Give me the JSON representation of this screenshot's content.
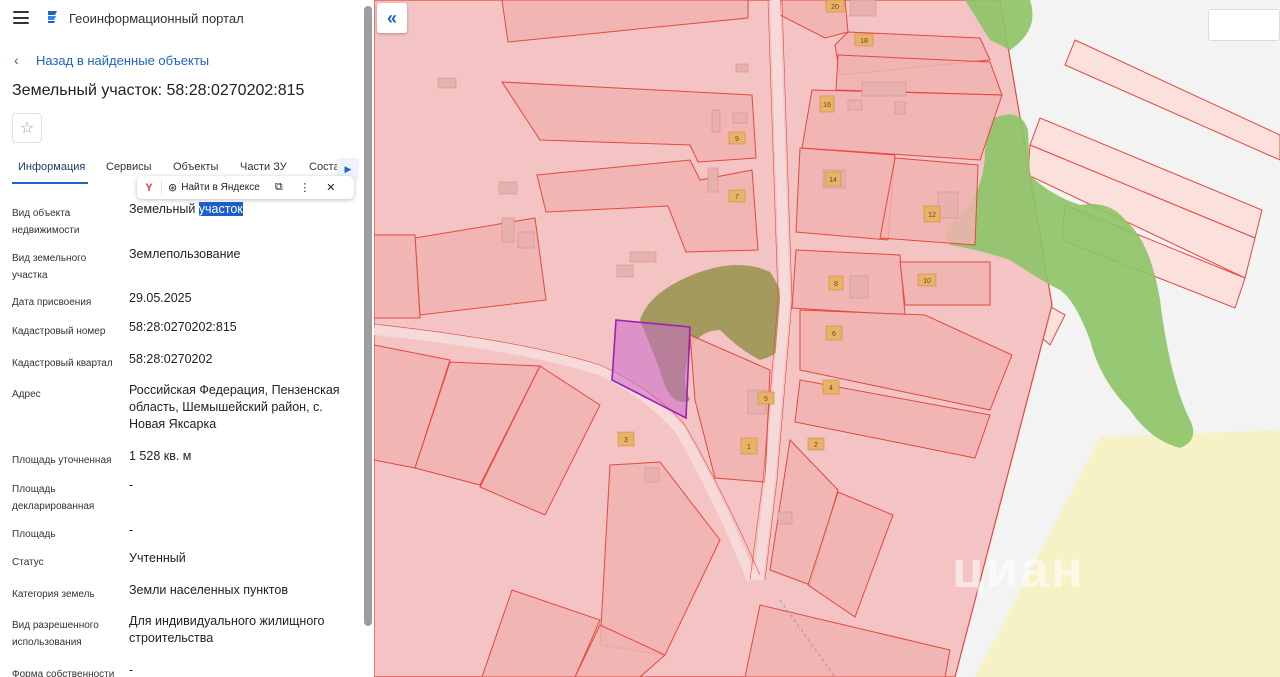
{
  "header": {
    "menu_icon": "hamburger-icon",
    "logo_icon": "portal-logo-icon",
    "title": "Геоинформационный портал"
  },
  "back_link": "Назад в найденные объекты",
  "object_title": "Земельный участок: 58:28:0270202:815",
  "tabs": [
    {
      "label": "Информация",
      "active": true
    },
    {
      "label": "Сервисы"
    },
    {
      "label": "Объекты"
    },
    {
      "label": "Части ЗУ"
    },
    {
      "label": "Соста"
    }
  ],
  "popup": {
    "find_label": "Найти в Яндексе"
  },
  "properties": [
    {
      "label": "Вид объекта недвижимости",
      "value_prefix": "Земельный ",
      "value_highlight": "участок"
    },
    {
      "label": "Вид земельного участка",
      "value": "Землепользование"
    },
    {
      "label": "Дата присвоения",
      "value": "29.05.2025"
    },
    {
      "label": "Кадастровый номер",
      "value": "58:28:0270202:815"
    },
    {
      "label": "Кадастровый квартал",
      "value": "58:28:0270202"
    },
    {
      "label": "Адрес",
      "value": "Российская Федерация, Пензенская область, Шемышейский район, с. Новая Яксарка"
    },
    {
      "label": "Площадь уточненная",
      "value": "1 528 кв. м"
    },
    {
      "label": "Площадь декларированная",
      "value": "-"
    },
    {
      "label": "Площадь",
      "value": "-"
    },
    {
      "label": "Статус",
      "value": "Учтенный"
    },
    {
      "label": "Категория земель",
      "value": "Земли населенных пунктов"
    },
    {
      "label": "Вид разрешенного использования",
      "value": "Для индивидуального жилищного строительства"
    },
    {
      "label": "Форма собственности",
      "value": "-"
    }
  ],
  "map": {
    "collapse_icon": "double-chevron-left-icon",
    "watermark": "циан",
    "parcel_numbers": [
      "20",
      "18",
      "16",
      "9",
      "7",
      "14",
      "12",
      "10",
      "8",
      "6",
      "4",
      "2",
      "5",
      "1",
      "3"
    ],
    "colors": {
      "parcel_fill": "#f4b7b7",
      "parcel_stroke": "#e5483e",
      "highlight": "#a01fb0",
      "forest": "#8dc467",
      "field": "#f7f2c6"
    }
  }
}
